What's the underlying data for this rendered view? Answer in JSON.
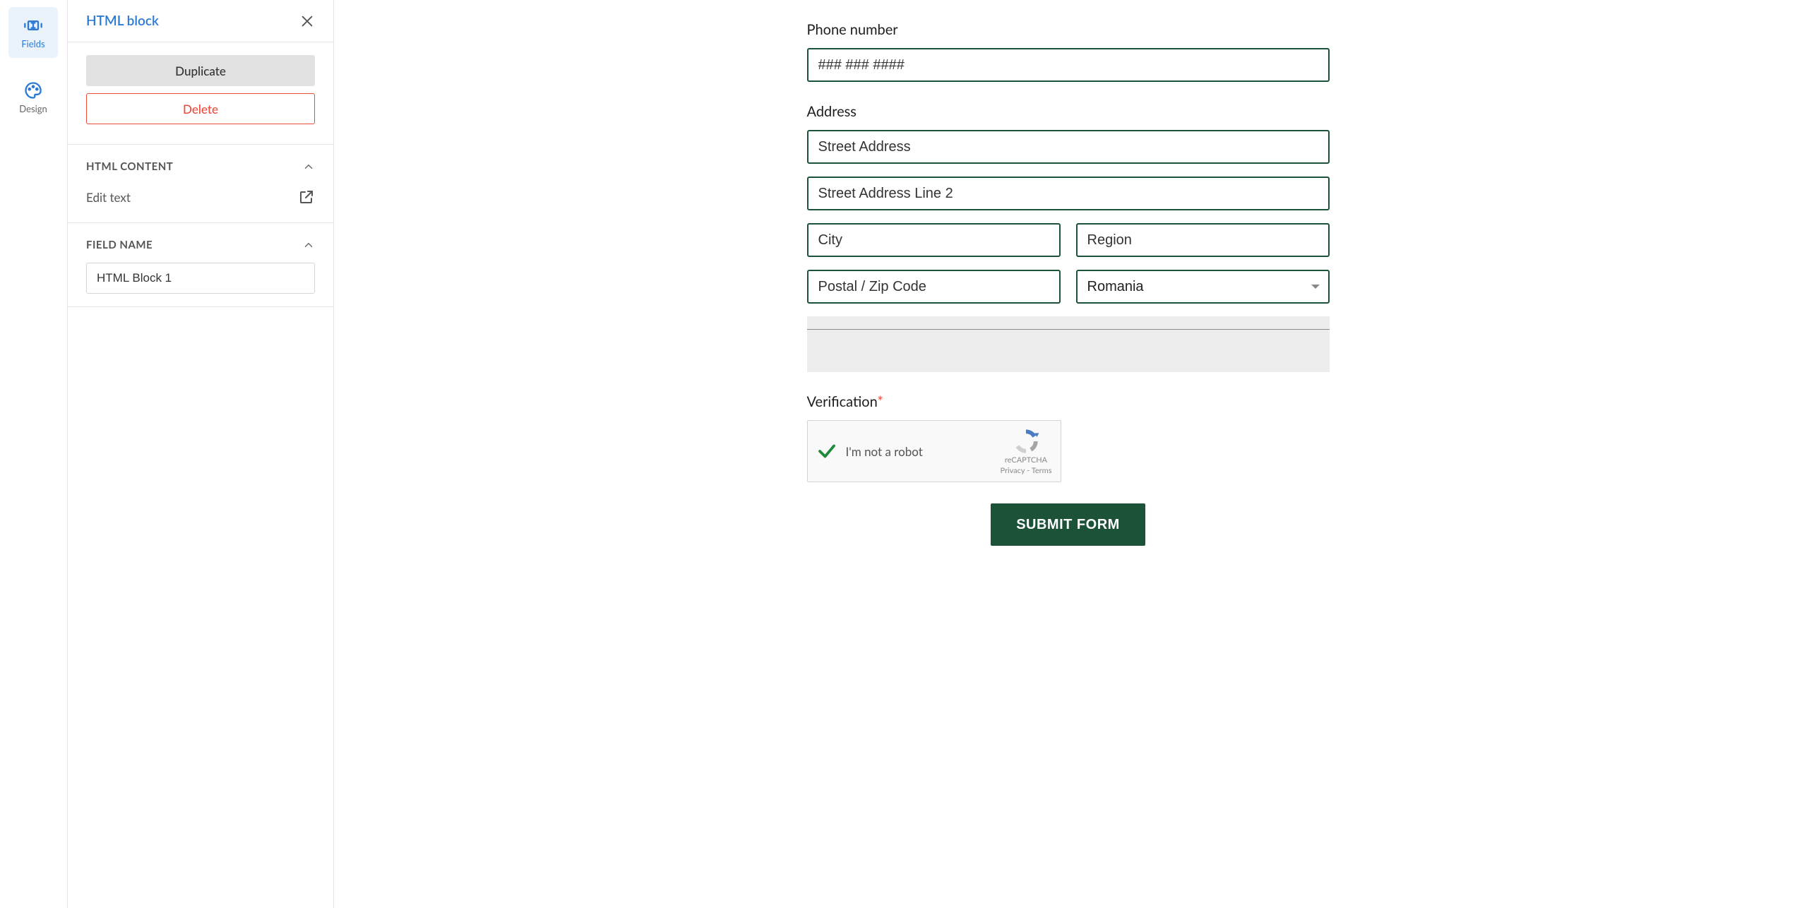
{
  "rail": {
    "fields_label": "Fields",
    "design_label": "Design"
  },
  "panel": {
    "title": "HTML block",
    "duplicate_label": "Duplicate",
    "delete_label": "Delete",
    "section_html_title": "HTML CONTENT",
    "edit_text_label": "Edit text",
    "section_field_name_title": "FIELD NAME",
    "field_name_value": "HTML Block 1"
  },
  "form": {
    "phone_label": "Phone number",
    "phone_placeholder": "### ### ####",
    "address_label": "Address",
    "street1_placeholder": "Street Address",
    "street2_placeholder": "Street Address Line 2",
    "city_placeholder": "City",
    "region_placeholder": "Region",
    "postal_placeholder": "Postal / Zip Code",
    "country_value": "Romania",
    "verification_label": "Verification",
    "captcha_text": "I'm not a robot",
    "captcha_badge": "reCAPTCHA",
    "captcha_privacy": "Privacy",
    "captcha_terms": "Terms",
    "submit_label": "SUBMIT FORM"
  },
  "colors": {
    "accent_blue": "#2b7bd6",
    "danger_red": "#ec4a3b",
    "form_border_green": "#1c5238",
    "submit_green": "#1c5238"
  }
}
